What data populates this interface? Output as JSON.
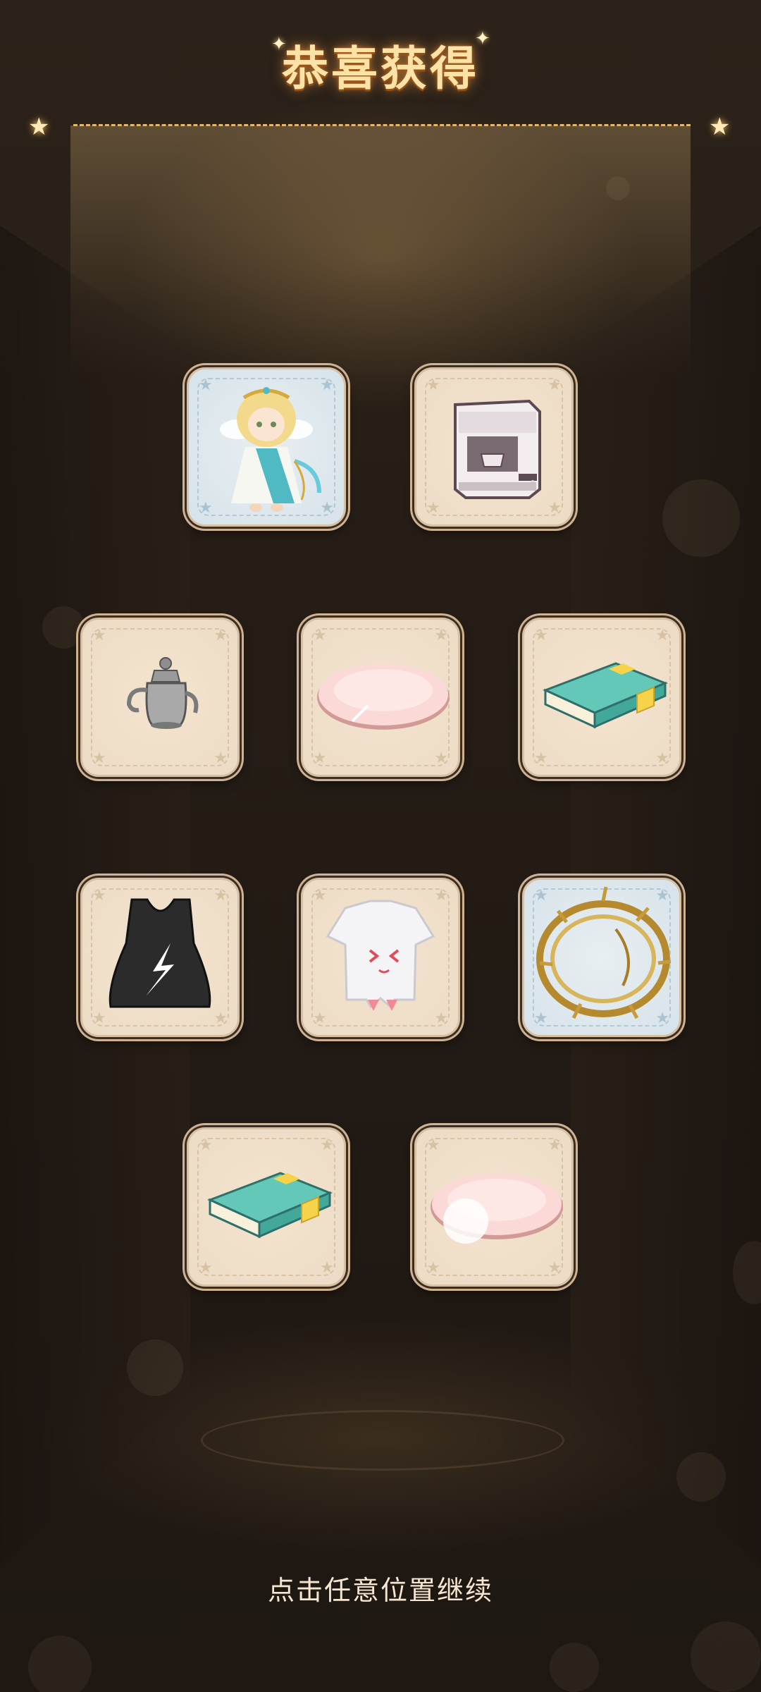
{
  "header": {
    "title": "恭喜获得"
  },
  "footer": {
    "continue_hint": "点击任意位置继续"
  },
  "colors": {
    "title_gold": "#fbe2a6",
    "card_common_bg": "#ecdcc6",
    "card_rare_bg": "#d6e3ea",
    "background": "#241c15"
  },
  "rewards": [
    {
      "name": "angel-character-card",
      "icon": "angel-character-icon",
      "rarity": "rare"
    },
    {
      "name": "espresso-machine",
      "icon": "espresso-machine-icon",
      "rarity": "common"
    },
    {
      "name": "silver-teapot",
      "icon": "teapot-icon",
      "rarity": "common"
    },
    {
      "name": "pink-round-rug",
      "icon": "pink-rug-icon",
      "rarity": "common"
    },
    {
      "name": "teal-book",
      "icon": "book-icon",
      "rarity": "common"
    },
    {
      "name": "black-tank-top",
      "icon": "black-tank-top-icon",
      "rarity": "common"
    },
    {
      "name": "white-cat-shirt",
      "icon": "white-shirt-icon",
      "rarity": "common"
    },
    {
      "name": "golden-thorn-halo",
      "icon": "golden-halo-icon",
      "rarity": "rare"
    },
    {
      "name": "teal-book",
      "icon": "book-icon",
      "rarity": "common"
    },
    {
      "name": "pink-round-rug",
      "icon": "pink-rug-icon",
      "rarity": "common"
    }
  ]
}
